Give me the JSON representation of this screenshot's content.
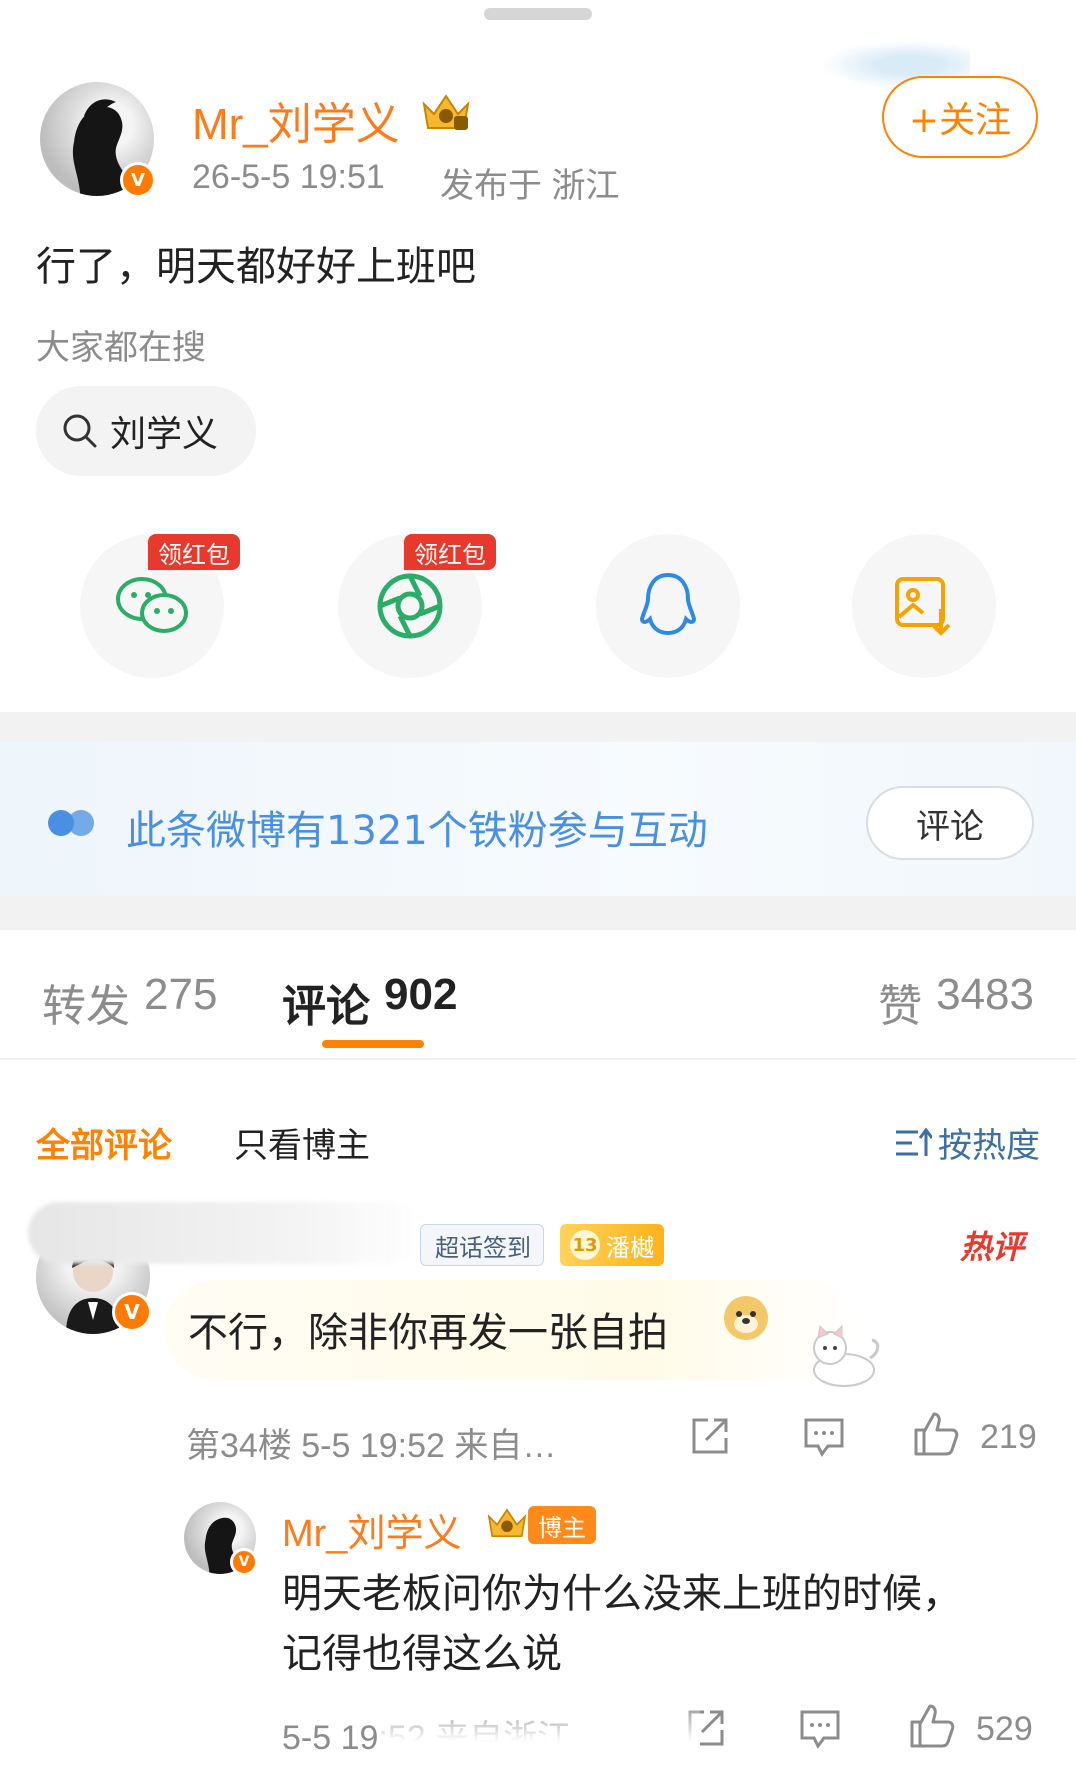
{
  "post": {
    "author": "Mr_刘学义",
    "verified_mark": "V",
    "timestamp": "26-5-5 19:51",
    "location": "发布于 浙江",
    "follow_label": "+关注",
    "text": "行了，明天都好好上班吧",
    "everyone_searching_label": "大家都在搜",
    "search_chip": "刘学义"
  },
  "share": {
    "redpack_label": "领红包",
    "items": [
      {
        "name": "wechat-icon",
        "color": "#2aae67"
      },
      {
        "name": "moments-icon",
        "color": "#2aae67"
      },
      {
        "name": "qq-icon",
        "color": "#2b8ae6"
      },
      {
        "name": "save-image-icon",
        "color": "#f5a300"
      }
    ]
  },
  "fans_banner": {
    "text": "此条微博有1321个铁粉参与互动",
    "button": "评论"
  },
  "tabs": {
    "repost": {
      "label": "转发",
      "count": "275"
    },
    "comment": {
      "label": "评论",
      "count": "902"
    },
    "like": {
      "label": "赞",
      "count": "3483"
    }
  },
  "filters": {
    "all": "全部评论",
    "host_only": "只看博主",
    "sort": "按热度"
  },
  "comment": {
    "badge_sign": "超话签到",
    "fan_level": "13",
    "fan_badge_name": "潘樾",
    "hot_tag": "热评",
    "text": "不行，除非你再发一张自拍",
    "meta": "第34楼 5-5 19:52 来自…",
    "likes": "219"
  },
  "reply": {
    "author": "Mr_刘学义",
    "host_badge": "博主",
    "text": "明天老板问你为什么没来上班的时候，记得也得这么说",
    "meta": "5-5 19:52 来自浙江",
    "likes": "529"
  },
  "colors": {
    "accent": "#ff8200",
    "link_blue": "#4a90e2",
    "hot_red": "#e8392d"
  }
}
